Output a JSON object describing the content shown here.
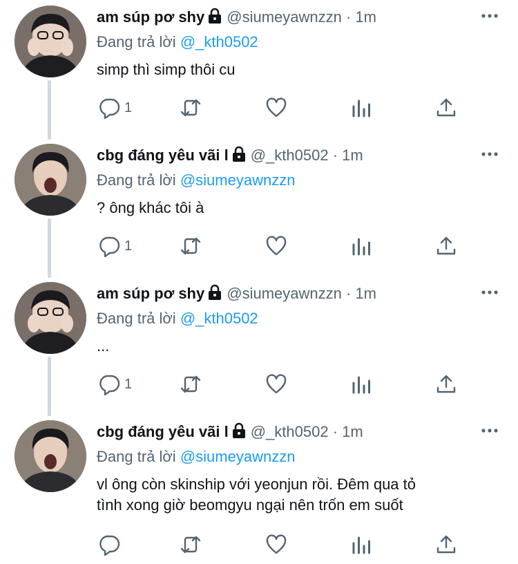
{
  "tweets": [
    {
      "name": "am súp pơ shy",
      "handle": "@siumeyawnzzn",
      "dot": " · ",
      "time": "1m",
      "replying_prefix": "Đang trả lời ",
      "replying_to": "@_kth0502",
      "text": "simp thì simp thôi cu",
      "reply_count": "1"
    },
    {
      "name": "cbg đáng yêu vãi l",
      "handle": "@_kth0502",
      "dot": " · ",
      "time": "1m",
      "replying_prefix": "Đang trả lời ",
      "replying_to": "@siumeyawnzzn",
      "text": "?  ông khác tôi à",
      "reply_count": "1"
    },
    {
      "name": "am súp pơ shy",
      "handle": "@siumeyawnzzn",
      "dot": " · ",
      "time": "1m",
      "replying_prefix": "Đang trả lời ",
      "replying_to": "@_kth0502",
      "text": "...",
      "reply_count": "1"
    },
    {
      "name": "cbg đáng yêu vãi l",
      "handle": "@_kth0502",
      "dot": " · ",
      "time": "1m",
      "replying_prefix": "Đang trả lời ",
      "replying_to": "@siumeyawnzzn",
      "text_line1": "vl ông còn skinship với yeonjun rồi. Đêm qua tỏ",
      "text_line2": "tình xong giờ beomgyu ngại nên trốn em suốt",
      "reply_count": ""
    }
  ],
  "icons": [
    "lock-icon",
    "more-icon",
    "reply-icon",
    "retweet-icon",
    "like-icon",
    "analytics-icon",
    "share-icon"
  ],
  "colors": {
    "text": "#0f1419",
    "secondary": "#536471",
    "mention": "#1d9bf0",
    "thread_line": "#cfd9de"
  }
}
